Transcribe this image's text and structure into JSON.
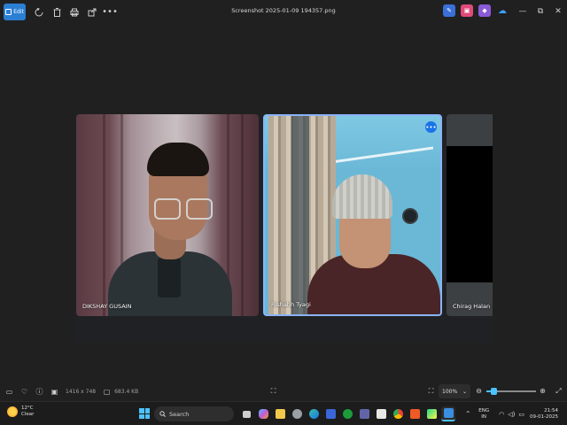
{
  "toolbar": {
    "edit_label": "Edit",
    "title": "Screenshot 2025-01-09 194357.png",
    "icons": [
      "rotate-icon",
      "delete-icon",
      "print-icon",
      "share-icon",
      "more-icon"
    ]
  },
  "window_controls": {
    "minimize": "—",
    "maximize": "⧉",
    "close": "✕"
  },
  "meeting": {
    "participants": [
      {
        "name": "DIKSHAY GUSAIN"
      },
      {
        "name": "Rishabh Tyagi"
      },
      {
        "name": "Chirag Halan"
      }
    ],
    "more_glyph": "•••"
  },
  "statusbar": {
    "dimensions": "1416 x 748",
    "file_size": "683.4 KB",
    "zoom": "100%",
    "zoom_level": 0.15
  },
  "taskbar": {
    "weather_temp": "12°C",
    "weather_desc": "Clear",
    "search_label": "Search",
    "lang_1": "ENG",
    "lang_2": "IN",
    "time": "21:54",
    "date": "09-01-2025"
  },
  "colors": {
    "accent": "#2b7fd3",
    "meet_border": "#8ab4f8",
    "slider": "#4cc2ff"
  }
}
